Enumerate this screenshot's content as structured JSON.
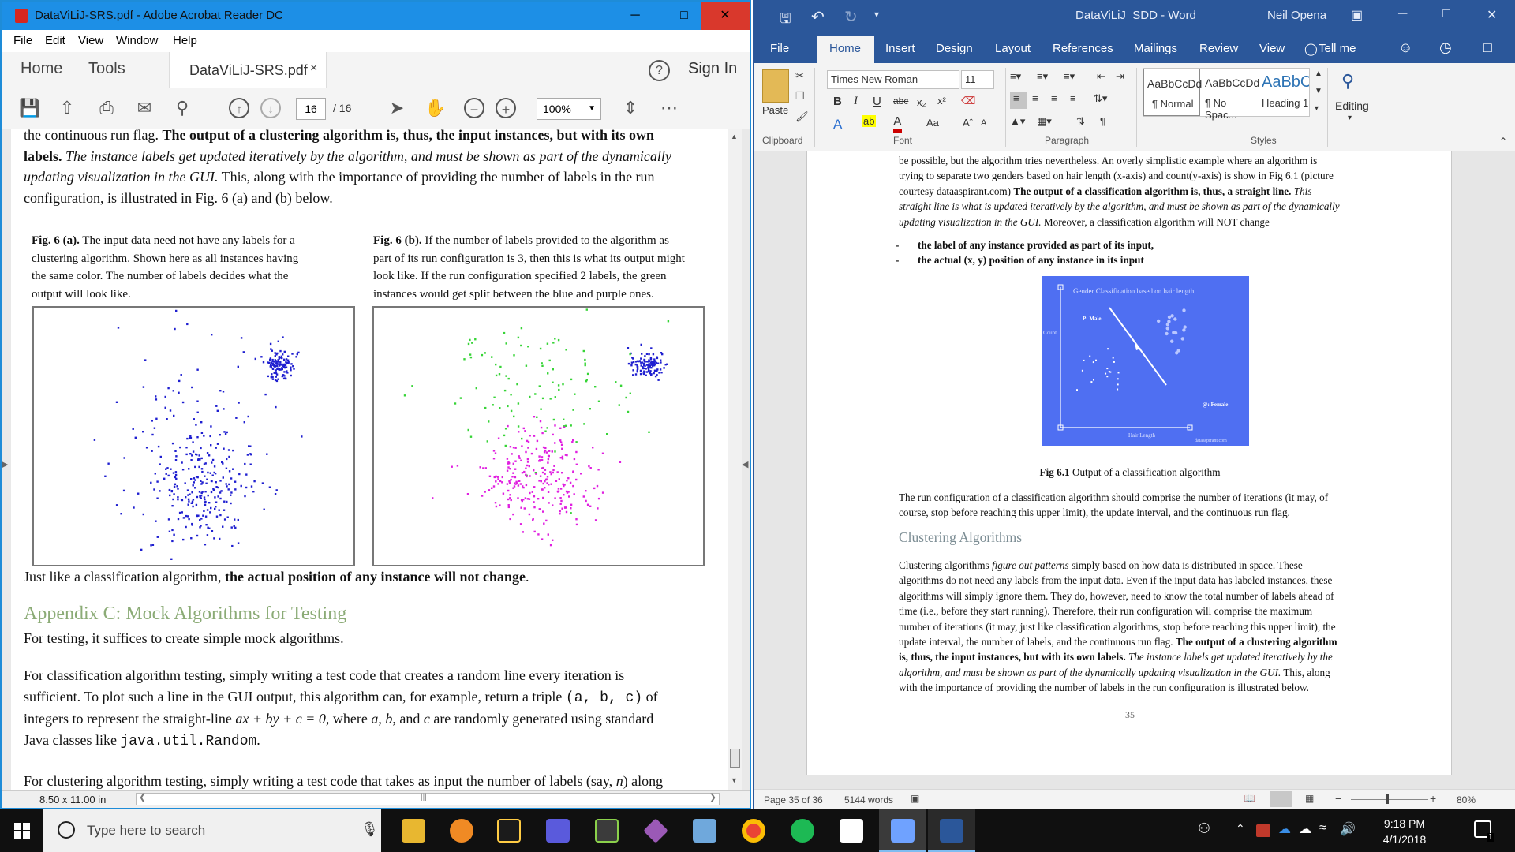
{
  "acrobat": {
    "window_title": "DataViLiJ-SRS.pdf - Adobe Acrobat Reader DC",
    "menu": [
      "File",
      "Edit",
      "View",
      "Window",
      "Help"
    ],
    "nav": {
      "home": "Home",
      "tools": "Tools",
      "tab": "DataViLiJ-SRS.pdf",
      "tab_close": "×",
      "help": "?",
      "sign_in": "Sign In"
    },
    "toolbar": {
      "page_current": "16",
      "page_total": "/ 16",
      "zoom": "100%"
    },
    "status": {
      "page_size": "8.50 x 11.00 in"
    },
    "doc": {
      "line1a": "the continuous run flag. ",
      "line1b": "The output of a clustering algorithm is, thus, the input instances, but with its own",
      "line2a": "labels.",
      "line2b": " The instance labels get updated iteratively by the algorithm, and must be shown as part of the dynamically",
      "line3a": "updating visualization in the GUI.",
      "line3b": " This, along with the importance of providing the number of labels in the run",
      "line4": "configuration, is illustrated in Fig. 6 (a) and (b) below.",
      "cap_a_bold": "Fig. 6 (a).",
      "cap_a": [
        " The input data need not have any labels for a",
        "clustering algorithm. Shown here as all instances having",
        "the same color. The number of labels decides what the",
        "output will look like."
      ],
      "cap_b_bold": "Fig. 6 (b).",
      "cap_b": [
        " If the number of labels provided to the algorithm as",
        "part of its run configuration is 3, then this is what its output might",
        "look like. If the run configuration specified 2 labels, the green",
        "instances would get split between the blue and purple ones."
      ],
      "after_a": "Just like a classification algorithm, ",
      "after_b": "the actual position of any instance will not change",
      "after_c": ".",
      "appendix_heading": "Appendix C: Mock Algorithms for Testing",
      "testing_intro": "For testing, it suffices to create simple mock algorithms.",
      "cls_1": "For classification algorithm testing, simply writing a test code that creates a random line every iteration is",
      "cls_2a": "sufficient. To plot such a line in the GUI output, this algorithm can, for example, return a triple ",
      "cls_2code": "(a, b, c)",
      "cls_2b": " of",
      "cls_3a": "integers to represent the straight-line ",
      "cls_3eq": "ax + by + c = 0",
      "cls_3b": ", where ",
      "cls_3c": "a",
      "cls_3d": ", ",
      "cls_3e": "b",
      "cls_3f": ", and ",
      "cls_3g": "c",
      "cls_3h": " are randomly generated using standard",
      "cls_4a": "Java classes like ",
      "cls_4code": "java.util.Random",
      "cls_4b": ".",
      "clu_1a": "For clustering algorithm testing, simply writing a test code that takes as input the number of labels (say, ",
      "clu_1n": "n",
      "clu_1b": ") along"
    }
  },
  "word": {
    "window_title": "DataViLiJ_SDD  -  Word",
    "user": "Neil Opena",
    "tabs": [
      "File",
      "Home",
      "Insert",
      "Design",
      "Layout",
      "References",
      "Mailings",
      "Review",
      "View",
      "Tell me"
    ],
    "ribbon": {
      "paste": "Paste",
      "clipboard": "Clipboard",
      "font_name": "Times New Roman",
      "font_size": "11",
      "font_group": "Font",
      "paragraph_group": "Paragraph",
      "styles_group": "Styles",
      "editing": "Editing",
      "styles": [
        {
          "preview": "AaBbCcDd",
          "name": "¶ Normal"
        },
        {
          "preview": "AaBbCcDd",
          "name": "¶ No Spac..."
        },
        {
          "preview": "AaBbC(",
          "name": "Heading 1"
        }
      ]
    },
    "page": {
      "p1": [
        "be possible, but the algorithm tries nevertheless. An overly simplistic example where an algorithm is",
        "trying to separate two genders based on hair length (x-axis) and count(y-axis) is show in Fig 6.1 (picture"
      ],
      "p1_3a": "courtesy dataaspirant.com) ",
      "p1_3b": "The output of a classification algorithm is, thus, a straight line.",
      "p1_3c": " This",
      "p1_4": "straight line is what is updated iteratively by the algorithm, and must be shown as part of the dynamically",
      "p1_5a": "updating visualization in the GUI.",
      "p1_5b": " Moreover, a classification algorithm will NOT change",
      "bullets": [
        "the label of any instance provided as part of its input,",
        "the actual (x, y) position of any instance in its input"
      ],
      "figure": {
        "title": "Gender Classification based on hair length",
        "legend_male": "P: Male",
        "legend_female": "@: Female",
        "y_label": "Count",
        "x_label": "Hair Length",
        "credit": "dataaspirant.com"
      },
      "fig_caption_bold": "Fig 6.1",
      "fig_caption": " Output of a classification algorithm",
      "p2": [
        "The run configuration of a classification algorithm should comprise the number of iterations (it may, of",
        "course, stop before reaching this upper limit), the update interval, and the continuous run flag."
      ],
      "heading": "Clustering Algorithms",
      "p3_1a": "Clustering algorithms ",
      "p3_1b": "figure out patterns",
      "p3_1c": " simply based on how data is distributed in space. These",
      "p3": [
        "algorithms do not need any labels from the input data. Even if the input data has labeled instances, these",
        "algorithms will simply ignore them. They do, however, need to know the total number of labels ahead of",
        "time (i.e., before they start running). Therefore, their run configuration will comprise the maximum",
        "number of iterations (it may, just like classification algorithms, stop before reaching this upper limit), the"
      ],
      "p3_6a": "update interval, the number of labels, and the continuous run flag. ",
      "p3_6b": "The output of a clustering algorithm",
      "p3_7a": "is, thus, the input instances, but with its own labels.",
      "p3_7b": " The instance labels get updated iteratively by the",
      "p3_8a": "algorithm, and must be shown as part of the dynamically updating visualization in the GUI.",
      "p3_8b": " This, along",
      "p3_9": "with the importance of providing the number of labels in the run configuration is illustrated below.",
      "page_number": "35"
    },
    "status": {
      "page": "Page 35 of 36",
      "words": "5144 words",
      "zoom": "80%"
    }
  },
  "taskbar": {
    "search_placeholder": "Type here to search",
    "time": "9:18 PM",
    "date": "4/1/2018",
    "notif_count": "1"
  },
  "colors": {
    "acrobat_title": "#1d8fe6",
    "word_blue": "#2b579a",
    "appendix_heading": "#8bab76",
    "figure_bg": "#4f6ff2",
    "blue_points": "#1f1fd0",
    "green_points": "#37d437",
    "magenta_points": "#e020e0"
  }
}
